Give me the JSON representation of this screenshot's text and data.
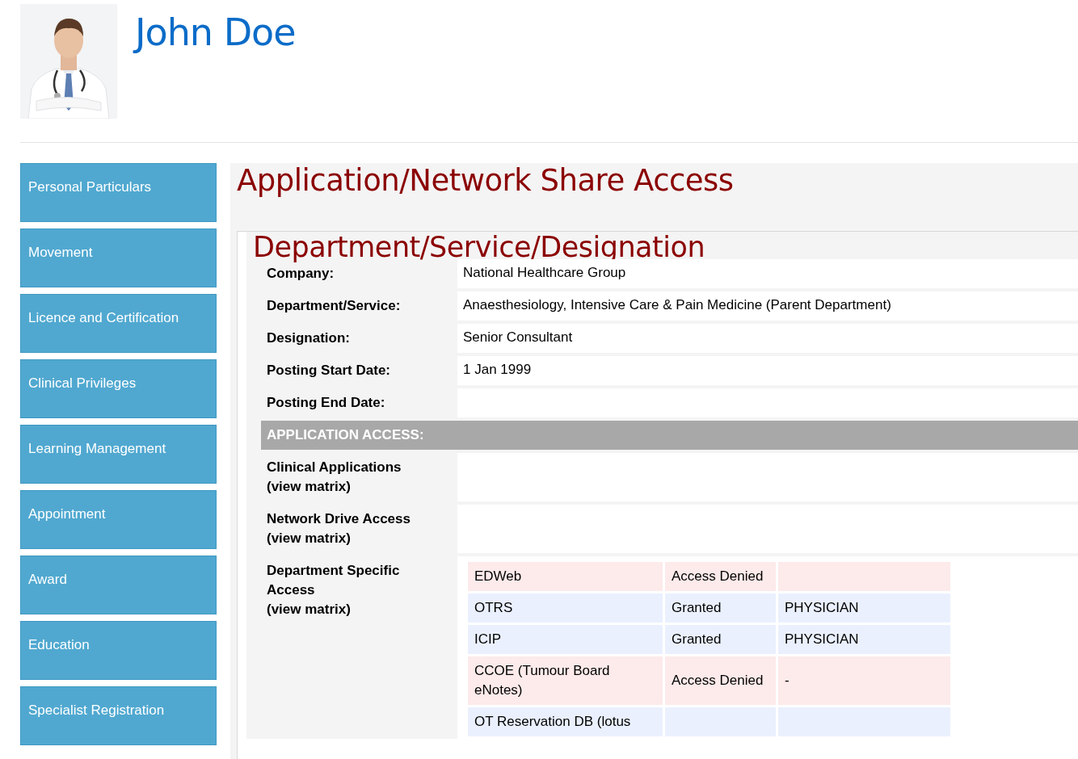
{
  "profile": {
    "name": "John Doe"
  },
  "sidebar": {
    "items": [
      {
        "label": "Personal Particulars"
      },
      {
        "label": "Movement"
      },
      {
        "label": "Licence and Certification"
      },
      {
        "label": "Clinical Privileges"
      },
      {
        "label": "Learning Management"
      },
      {
        "label": "Appointment"
      },
      {
        "label": "Award"
      },
      {
        "label": "Education"
      },
      {
        "label": "Specialist Registration"
      }
    ]
  },
  "main": {
    "title": "Application/Network Share Access",
    "section": {
      "title": "Department/Service/Designation",
      "fields": [
        {
          "label": "Company:",
          "value": "National Healthcare Group"
        },
        {
          "label": "Department/Service:",
          "value": "Anaesthesiology, Intensive Care & Pain Medicine (Parent Department)"
        },
        {
          "label": "Designation:",
          "value": "Senior Consultant"
        },
        {
          "label": "Posting Start Date:",
          "value": "1 Jan 1999"
        },
        {
          "label": "Posting End Date:"
        }
      ],
      "access_header": "APPLICATION ACCESS:",
      "access": [
        {
          "label": "Clinical Applications\n(view matrix)"
        },
        {
          "label": "Network Drive Access\n(view matrix)"
        },
        {
          "label": "Department Specific Access\n(view matrix)",
          "rows": [
            {
              "kind": "denied",
              "application": "EDWeb",
              "status": "Access Denied"
            },
            {
              "kind": "granted",
              "application": "OTRS",
              "status": "Granted",
              "role": "PHYSICIAN"
            },
            {
              "kind": "granted",
              "application": "ICIP",
              "status": "Granted",
              "role": "PHYSICIAN"
            },
            {
              "kind": "denied",
              "application": "CCOE (Tumour Board eNotes)",
              "status": "Access Denied",
              "role": "-"
            },
            {
              "kind": "granted",
              "application": "OT Reservation DB (lotus"
            }
          ]
        }
      ]
    }
  }
}
